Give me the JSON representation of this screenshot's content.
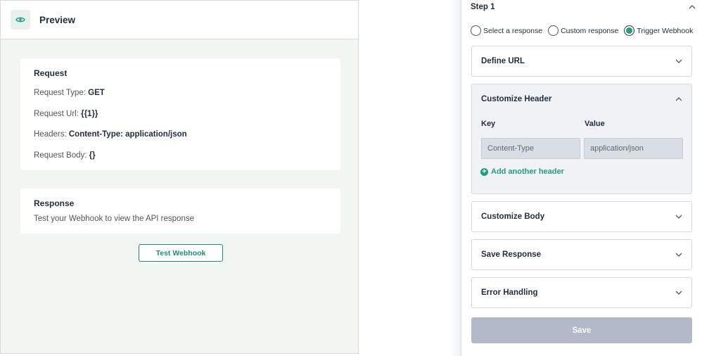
{
  "preview": {
    "title": "Preview",
    "request": {
      "title": "Request",
      "type_label": "Request Type: ",
      "type_value": "GET",
      "url_label": "Request Url: ",
      "url_value": "{{1}}",
      "headers_label": "Headers: ",
      "headers_value": "Content-Type: application/json",
      "body_label": "Request Body: ",
      "body_value": "{}"
    },
    "response": {
      "title": "Response",
      "text": "Test your Webhook to view the API response"
    },
    "test_button": "Test Webhook"
  },
  "settings": {
    "step_title": "Step 1",
    "radios": [
      {
        "label": "Select a response",
        "checked": false
      },
      {
        "label": "Custom response",
        "checked": false
      },
      {
        "label": "Trigger Webhook",
        "checked": true
      }
    ],
    "sections": {
      "define_url": "Define URL",
      "customize_header": "Customize Header",
      "customize_body": "Customize Body",
      "save_response": "Save Response",
      "error_handling": "Error Handling"
    },
    "header_editor": {
      "key_label": "Key",
      "value_label": "Value",
      "key_value": "Content-Type",
      "value_value": "application/json",
      "add_label": "Add another header"
    },
    "save_button": "Save"
  },
  "colors": {
    "accent": "#1e9f80",
    "preview_bg": "#f1f6f2",
    "save_disabled": "#b3b9c9"
  }
}
